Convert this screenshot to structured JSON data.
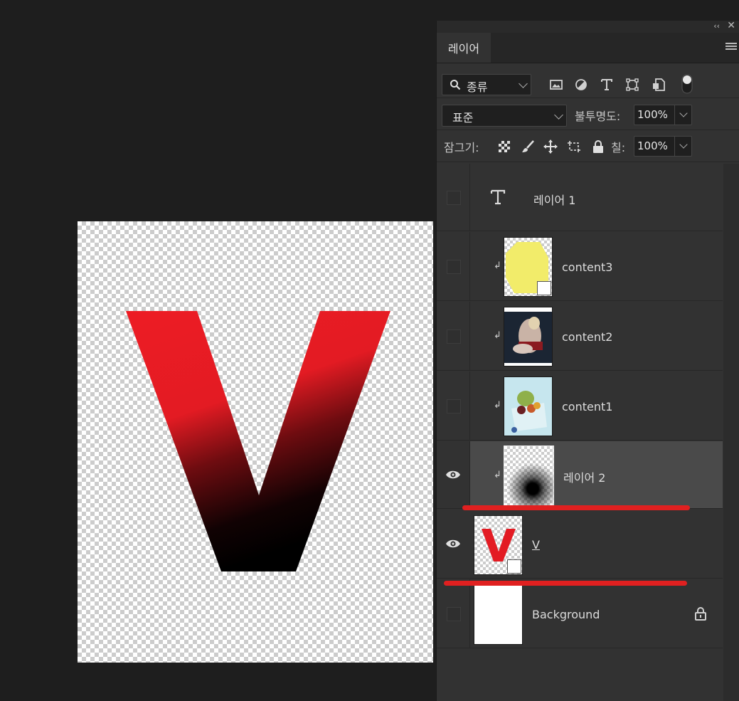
{
  "panel": {
    "tab_label": "레이어",
    "filter": {
      "selected": "종류"
    },
    "blend_mode": {
      "selected": "표준"
    },
    "opacity": {
      "label": "불투명도:",
      "value": "100%"
    },
    "lock": {
      "label": "잠그기:"
    },
    "fill": {
      "label": "칠:",
      "value": "100%"
    }
  },
  "layers": [
    {
      "name": "레이어 1",
      "type": "text",
      "visible": false,
      "clipped": false
    },
    {
      "name": "content3",
      "type": "smart-object",
      "visible": false,
      "clipped": true
    },
    {
      "name": "content2",
      "type": "image",
      "visible": false,
      "clipped": true
    },
    {
      "name": "content1",
      "type": "image",
      "visible": false,
      "clipped": true
    },
    {
      "name": "레이어 2",
      "type": "pixel",
      "visible": true,
      "clipped": true,
      "selected": true
    },
    {
      "name": "V",
      "type": "smart-object",
      "visible": true,
      "clipped": false
    },
    {
      "name": "Background",
      "type": "background",
      "visible": false,
      "locked": true
    }
  ],
  "colors": {
    "accent_red": "#e31b23",
    "annotation_red": "#e02020",
    "panel_bg": "#323232"
  }
}
